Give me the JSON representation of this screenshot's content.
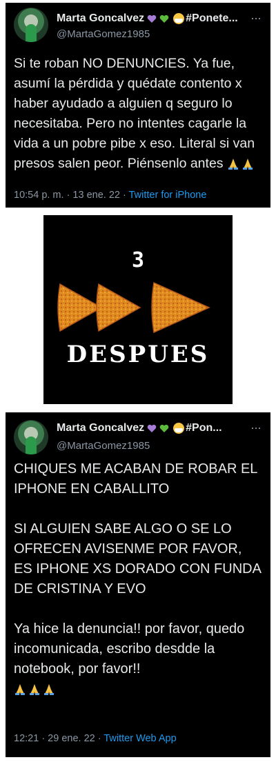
{
  "tweet1": {
    "name": "Marta Goncalvez",
    "hashtag": "#Ponete...",
    "handle": "@MartaGomez1985",
    "more": "···",
    "text": "Si te roban NO DENUNCIES. Ya fue, asumí la pérdida y quédate contento x haber ayudado a alguien q seguro lo necesitaba. Pero no intentes cagarle la vida a un pobre pibe x eso. Literal si van presos salen peor. Piénsenlo antes",
    "emoji": [
      "praying-hands",
      "praying-hands"
    ],
    "time": "10:54 p. m. · 13 ene. 22 · ",
    "source": "Twitter for iPhone"
  },
  "meme": {
    "number": "3",
    "word": "DESPUES",
    "icon": "fast-forward-doritos"
  },
  "tweet2": {
    "name": "Marta Goncalvez",
    "hashtag": "#Pon...",
    "handle": "@MartaGomez1985",
    "more": "···",
    "text": "CHIQUES ME ACABAN DE ROBAR EL IPHONE EN CABALLITO\n\nSI ALGUIEN SABE ALGO O SE LO OFRECEN AVISENME POR FAVOR, ES IPHONE XS DORADO CON FUNDA DE CRISTINA Y EVO\n\nYa hice la denuncia!! por favor, quedo incomunicada, escribo desdde la notebook, por favor!!",
    "emoji": [
      "praying-hands",
      "praying-hands",
      "praying-hands"
    ],
    "time": "12:21 · 29 ene. 22 · ",
    "source": "Twitter Web App"
  },
  "colors": {
    "background": "#000000",
    "text": "#e7e9ea",
    "muted": "#8b98a5",
    "link": "#1d9bf0",
    "purple_heart": "#a67cd6",
    "green_heart": "#5cbb3c",
    "chip": "#e08a1e"
  }
}
